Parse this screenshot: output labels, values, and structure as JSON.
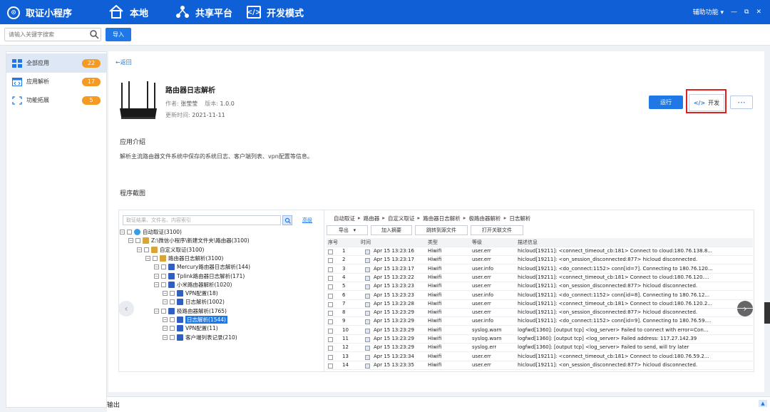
{
  "app": {
    "brand": "取证小程序"
  },
  "nav_tabs": [
    {
      "label": "本地",
      "icon": "home-icon"
    },
    {
      "label": "共享平台",
      "icon": "share-icon"
    },
    {
      "label": "开发模式",
      "icon": "code-icon"
    }
  ],
  "window": {
    "assist": "辅助功能",
    "assist_arrow": "▾",
    "minimize": "—",
    "maximize": "⧉",
    "close": "✕"
  },
  "toolbar": {
    "search_placeholder": "请输入关键字搜索",
    "import_label": "导入"
  },
  "sidebar": {
    "items": [
      {
        "label": "全部应用",
        "count": "22",
        "icon": "grid-icon",
        "active": true
      },
      {
        "label": "应用解析",
        "count": "17",
        "icon": "code-icon",
        "active": false
      },
      {
        "label": "功能拓展",
        "count": "5",
        "icon": "extend-icon",
        "active": false
      }
    ]
  },
  "detail": {
    "back_label": "返回",
    "name": "路由器日志解析",
    "author_label": "作者:",
    "author": "张莹莹",
    "version_label": "版本:",
    "version": "1.0.0",
    "updated_label": "更新时间:",
    "updated": "2021-11-11",
    "run_label": "运行",
    "dev_label": "开发",
    "more_label": "···",
    "intro_title": "应用介绍",
    "intro_text": "解析主流路由器文件系统中保存的系统日志、客户端列表、vpn配置等信息。",
    "screens_title": "程序截图"
  },
  "screenshot": {
    "tree_search_placeholder": "取证结果、文件名、内容索引",
    "tree_adv": "高级",
    "tree": [
      {
        "label": "自动取证(3100)",
        "indent": 0,
        "selected": false
      },
      {
        "label": "Z:\\微信小程序\\新建文件夹\\路由器(3100)",
        "indent": 1,
        "selected": false
      },
      {
        "label": "自定义取证(3100)",
        "indent": 2,
        "selected": false
      },
      {
        "label": "路由器日志解析(3100)",
        "indent": 3,
        "selected": false
      },
      {
        "label": "Mercury路由器日志解析(144)",
        "indent": 4,
        "selected": false
      },
      {
        "label": "Tplink路由器日志解析(171)",
        "indent": 4,
        "selected": false
      },
      {
        "label": "小米路由器解析(1020)",
        "indent": 4,
        "selected": false
      },
      {
        "label": "VPN配置(18)",
        "indent": 5,
        "selected": false
      },
      {
        "label": "日志解析(1002)",
        "indent": 5,
        "selected": false
      },
      {
        "label": "极路由器解析(1765)",
        "indent": 4,
        "selected": false
      },
      {
        "label": "日志解析(1544)",
        "indent": 5,
        "selected": true
      },
      {
        "label": "VPN配置(11)",
        "indent": 5,
        "selected": false
      },
      {
        "label": "客户端列表记录(210)",
        "indent": 5,
        "selected": false
      }
    ],
    "crumbs": [
      "自动取证",
      "路由器",
      "自定义取证",
      "路由器日志解析",
      "极路由器解析",
      "日志解析"
    ],
    "crumb_sep": "▸",
    "buttons": [
      "导出",
      "加入摘要",
      "跳转到源文件",
      "打开关联文件"
    ],
    "export_arrow": "▾",
    "columns": [
      "序号",
      "时间",
      "类型",
      "等级",
      "描述信息"
    ],
    "rows": [
      [
        "1",
        "Apr 15 13:23:16",
        "Hiwifi",
        "user.err",
        "hicloud[19211]: <connect_timeout_cb:181> Connect to cloud:180.76.138.8..."
      ],
      [
        "2",
        "Apr 15 13:23:17",
        "Hiwifi",
        "user.err",
        "hicloud[19211]: <on_session_disconnected:877> hicloud disconnected."
      ],
      [
        "3",
        "Apr 15 13:23:17",
        "Hiwifi",
        "user.info",
        "hicloud[19211]: <do_connect:1152> conn[id=7]. Connecting to 180.76.120..."
      ],
      [
        "4",
        "Apr 15 13:23:22",
        "Hiwifi",
        "user.err",
        "hicloud[19211]: <connect_timeout_cb:181> Connect to cloud:180.76.120...."
      ],
      [
        "5",
        "Apr 15 13:23:23",
        "Hiwifi",
        "user.err",
        "hicloud[19211]: <on_session_disconnected:877> hicloud disconnected."
      ],
      [
        "6",
        "Apr 15 13:23:23",
        "Hiwifi",
        "user.info",
        "hicloud[19211]: <do_connect:1152> conn[id=8]. Connecting to 180.76.12..."
      ],
      [
        "7",
        "Apr 15 13:23:28",
        "Hiwifi",
        "user.err",
        "hicloud[19211]: <connect_timeout_cb:181> Connect to cloud:180.76.120.2..."
      ],
      [
        "8",
        "Apr 15 13:23:29",
        "Hiwifi",
        "user.err",
        "hicloud[19211]: <on_session_disconnected:877> hicloud disconnected."
      ],
      [
        "9",
        "Apr 15 13:23:29",
        "Hiwifi",
        "user.info",
        "hicloud[19211]: <do_connect:1152> conn[id=9]. Connecting to 180.76.59...."
      ],
      [
        "10",
        "Apr 15 13:23:29",
        "Hiwifi",
        "syslog.warn",
        "logfwd[1360]: [output tcp] <log_server> Failed to connect with error=Con..."
      ],
      [
        "11",
        "Apr 15 13:23:29",
        "Hiwifi",
        "syslog.warn",
        "logfwd[1360]: [output tcp] <log_server> Failed address: 117.27.142.39"
      ],
      [
        "12",
        "Apr 15 13:23:29",
        "Hiwifi",
        "syslog.err",
        "logfwd[1360]: [output tcp] <log_server> Failed to send, will try later"
      ],
      [
        "13",
        "Apr 15 13:23:34",
        "Hiwifi",
        "user.err",
        "hicloud[19211]: <connect_timeout_cb:181> Connect to cloud:180.76.59.2..."
      ],
      [
        "14",
        "Apr 15 13:23:35",
        "Hiwifi",
        "user.err",
        "hicloud[19211]: <on_session_disconnected:877> hicloud disconnected."
      ]
    ]
  },
  "output_panel": {
    "label": "输出",
    "toggle": "▲"
  },
  "colors": {
    "brand_blue": "#0f5fd6",
    "accent": "#1f78e6",
    "badge": "#f59a23",
    "highlight": "#e02020"
  }
}
